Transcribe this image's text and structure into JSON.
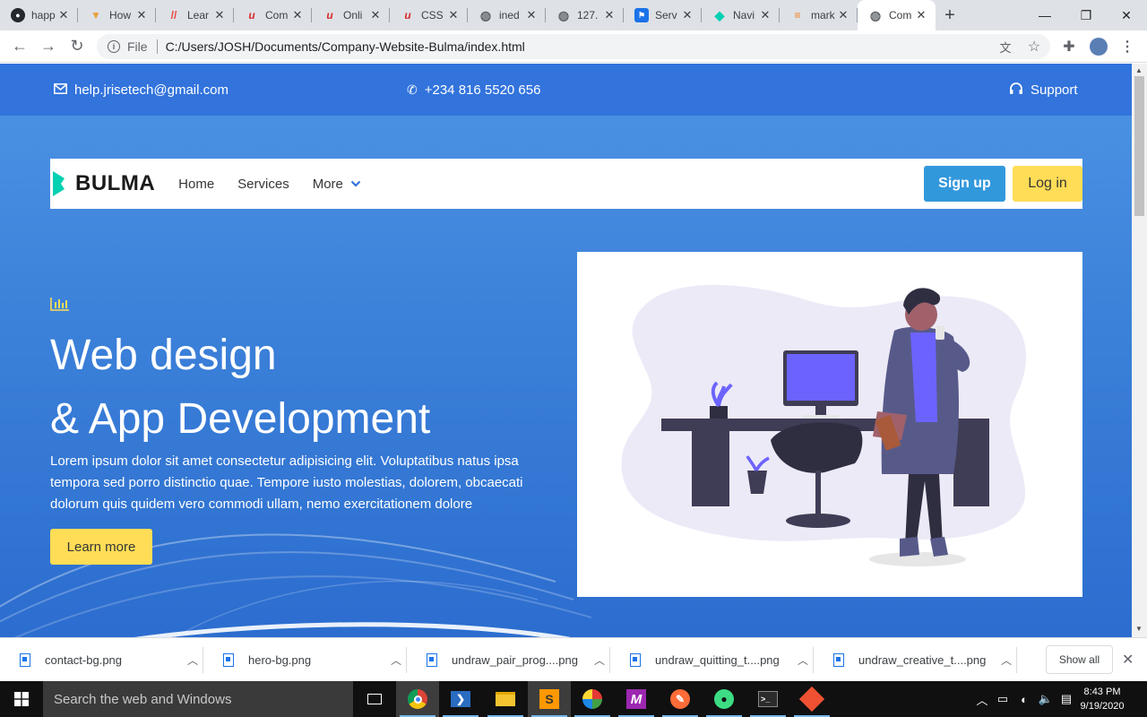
{
  "browser": {
    "tabs": [
      {
        "title": "happ",
        "icon": "github-icon"
      },
      {
        "title": "How",
        "icon": "bookmark-icon"
      },
      {
        "title": "Lear",
        "icon": "stripes-icon"
      },
      {
        "title": "Com",
        "icon": "udemy-icon"
      },
      {
        "title": "Onli",
        "icon": "udemy-icon"
      },
      {
        "title": "CSS",
        "icon": "udemy-icon"
      },
      {
        "title": "ined",
        "icon": "globe-icon"
      },
      {
        "title": "127.",
        "icon": "globe-icon"
      },
      {
        "title": "Serv",
        "icon": "flag-icon"
      },
      {
        "title": "Navi",
        "icon": "bulma-icon"
      },
      {
        "title": "mark",
        "icon": "stackoverflow-icon"
      },
      {
        "title": "Com",
        "icon": "globe-icon",
        "active": true
      }
    ],
    "address": {
      "scheme_label": "File",
      "url": "C:/Users/JOSH/Documents/Company-Website-Bulma/index.html"
    }
  },
  "page": {
    "topbar": {
      "email": "help.jrisetech@gmail.com",
      "phone": "+234 816 5520 656",
      "support": "Support"
    },
    "navbar": {
      "logo": "BULMA",
      "links": [
        "Home",
        "Services",
        "More"
      ],
      "signup": "Sign up",
      "login": "Log in"
    },
    "hero": {
      "headline_1": "Web design",
      "headline_2": "& App Development",
      "body": "Lorem ipsum dolor sit amet consectetur adipisicing elit. Voluptatibus natus ipsa tempora sed porro distinctio quae. Tempore iusto molestias, dolorem, obcaecati dolorum quis quidem vero commodi ullam, nemo exercitationem dolore",
      "cta": "Learn more"
    },
    "colors": {
      "primary": "#3273dc",
      "info": "#3298dc",
      "warning": "#ffdd57",
      "bulma_turquoise": "#00d1b2"
    }
  },
  "downloads": {
    "items": [
      "contact-bg.png",
      "hero-bg.png",
      "undraw_pair_prog....png",
      "undraw_quitting_t....png",
      "undraw_creative_t....png"
    ],
    "show_all": "Show all"
  },
  "taskbar": {
    "search_placeholder": "Search the web and Windows",
    "time": "8:43 PM",
    "date": "9/19/2020"
  }
}
